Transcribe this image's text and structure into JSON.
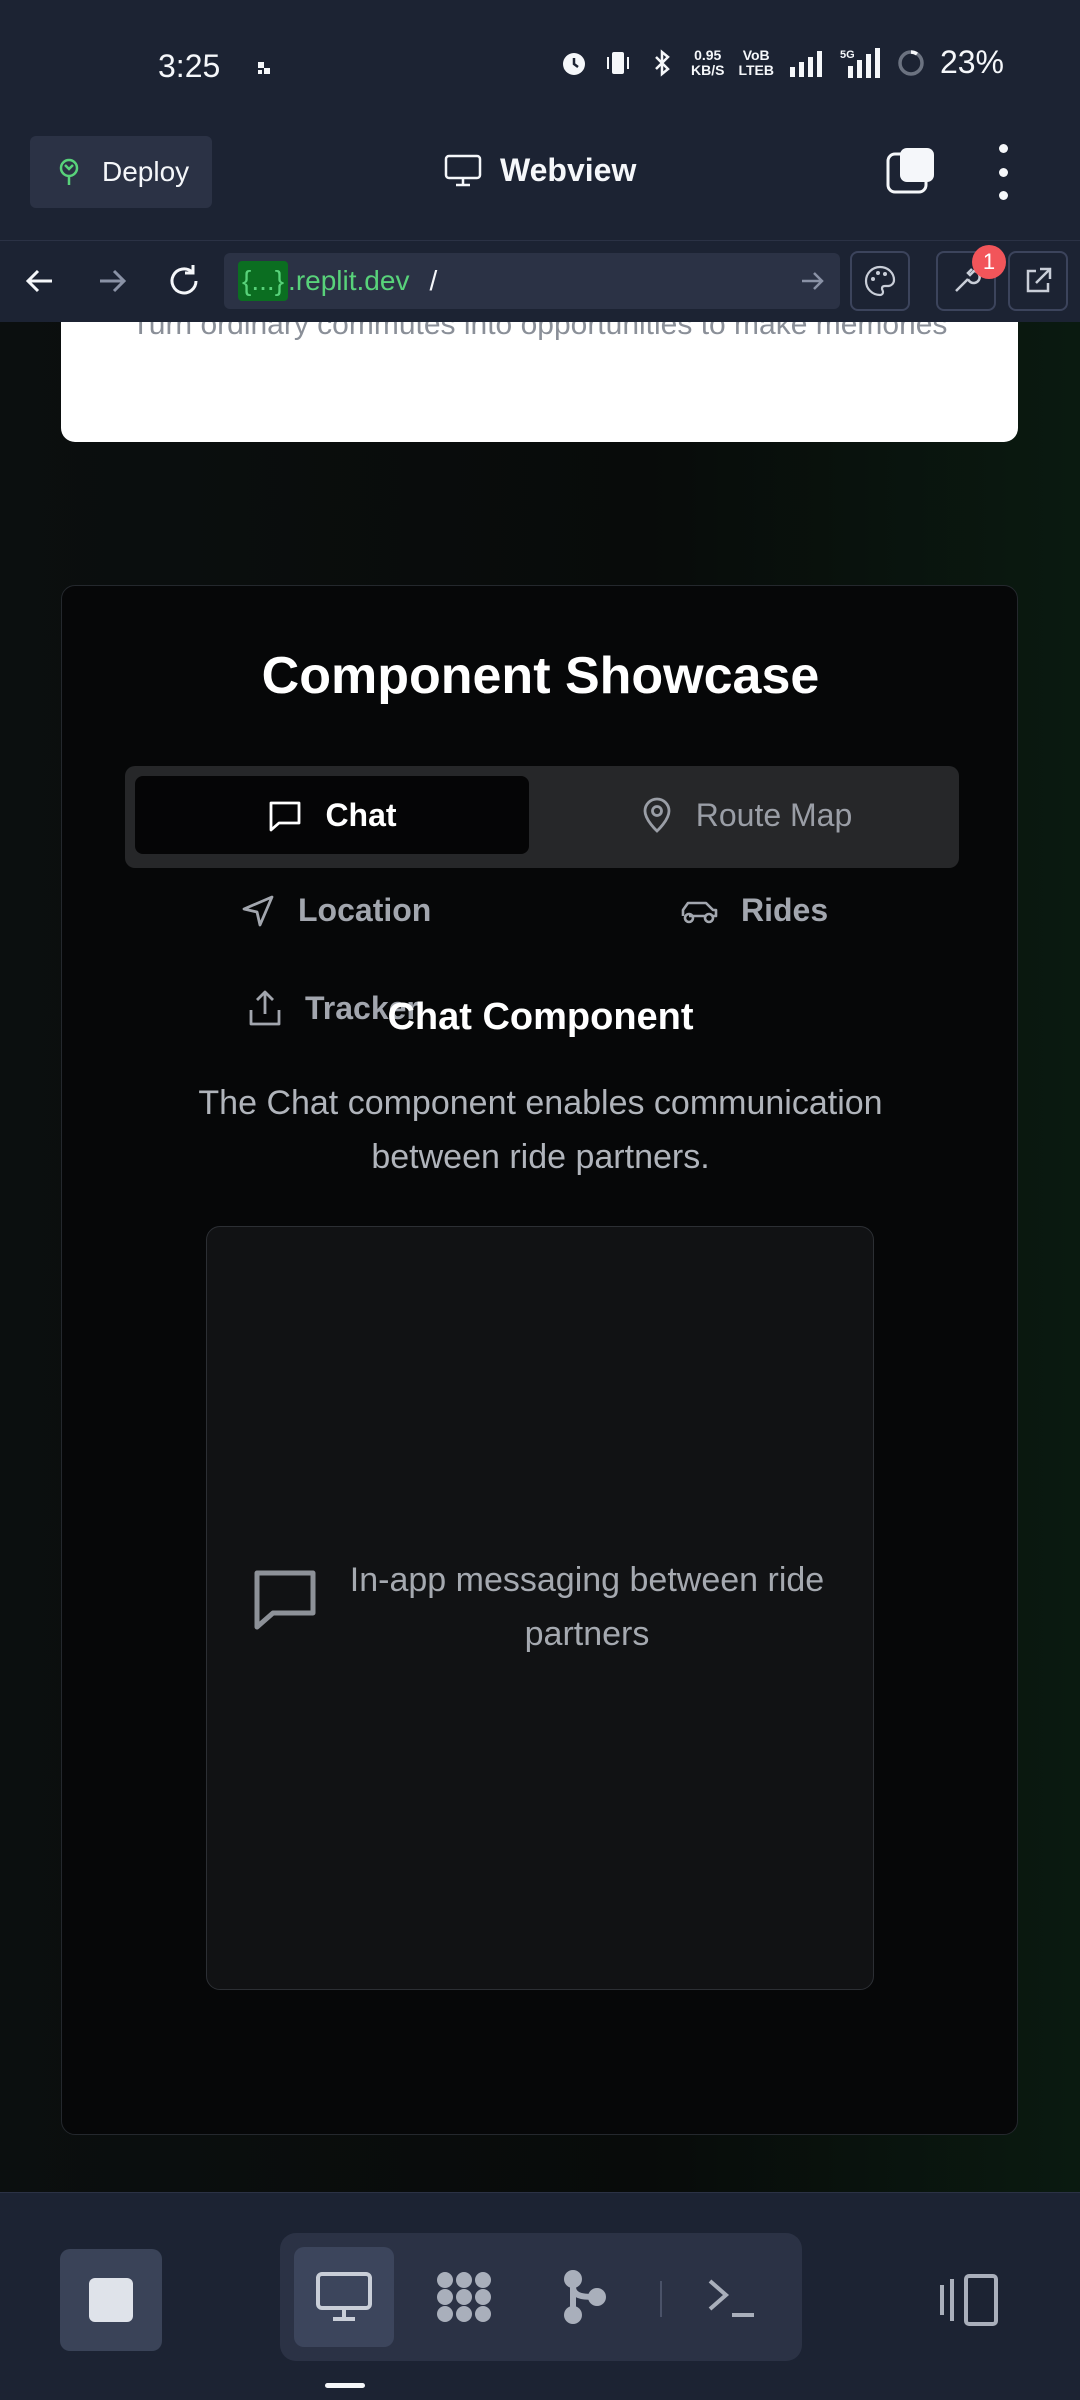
{
  "status_bar": {
    "time": "3:25",
    "net_speed_value": "0.95",
    "net_speed_unit": "KB/S",
    "volte_top": "VoB",
    "volte_bottom": "LTEB",
    "battery": "23%"
  },
  "app_bar": {
    "deploy_label": "Deploy",
    "title": "Webview"
  },
  "url_bar": {
    "badge": "{...}",
    "domain": ".replit.dev",
    "path": "/",
    "notification_count": "1"
  },
  "page": {
    "card_text": "Turn ordinary commutes into opportunities to make memories",
    "showcase_title": "Component Showcase",
    "tabs": [
      {
        "label": "Chat",
        "active": true
      },
      {
        "label": "Route Map",
        "active": false
      }
    ],
    "subtabs": [
      {
        "label": "Location"
      },
      {
        "label": "Rides"
      },
      {
        "label": "Tracker"
      }
    ],
    "component_title": "Chat Component",
    "component_desc": "The Chat component enables communication between ride partners.",
    "demo_text": "In-app messaging between ride partners"
  },
  "colors": {
    "accent_green": "#58d27a",
    "badge_red": "#f2555a",
    "chrome_bg": "#1c2333"
  }
}
